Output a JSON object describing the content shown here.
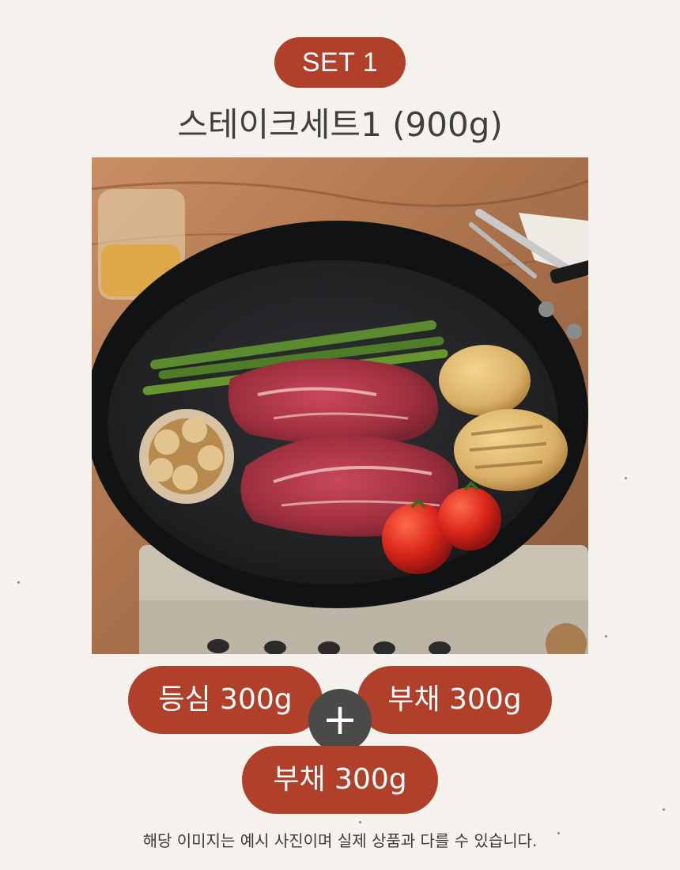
{
  "header": {
    "set_badge": "SET 1",
    "title": "스테이크세트1 (900g)"
  },
  "image": {
    "name": "steak-set-photo",
    "content": [
      "steak",
      "asparagus",
      "garlic",
      "potato",
      "cherry tomatoes",
      "frying pan",
      "portable stove"
    ]
  },
  "items": [
    {
      "label": "등심 300g"
    },
    {
      "label": "부채 300g"
    },
    {
      "label": "부채 300g"
    }
  ],
  "plus_symbol": "+",
  "disclaimer": "해당 이미지는 예시 사진이며 실제 상품과 다를 수 있습니다.",
  "colors": {
    "accent": "#b1402b",
    "plus_circle": "#4a4a4a",
    "background": "#f5f2ee",
    "text": "#3f3f3f"
  }
}
